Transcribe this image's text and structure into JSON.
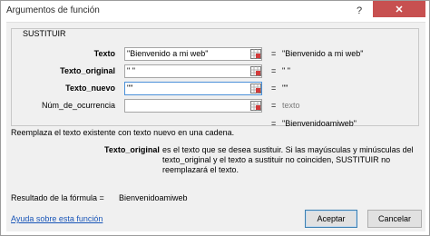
{
  "window": {
    "title": "Argumentos de función",
    "help_icon": "?",
    "close_icon": "✕"
  },
  "group": {
    "legend": "SUSTITUIR"
  },
  "args": [
    {
      "label": "Texto",
      "value": "\"Bienvenido a mi web\"",
      "evaluated": "\"Bienvenido a mi web\"",
      "bold": true
    },
    {
      "label": "Texto_original",
      "value": "\" \"",
      "evaluated": "\" \"",
      "bold": true
    },
    {
      "label": "Texto_nuevo",
      "value": "\"\"",
      "evaluated": "\"\"",
      "bold": true
    },
    {
      "label": "Núm_de_ocurrencia",
      "value": "",
      "evaluated": "texto",
      "bold": false
    }
  ],
  "function_result": "\"Bienvenidoamiweb\"",
  "description": "Reemplaza el texto existente con texto nuevo en una cadena.",
  "param_help": {
    "name": "Texto_original",
    "text": "es el texto que se desea sustituir. Si las mayúsculas y minúsculas del texto_original y el texto a sustituir no coinciden, SUSTITUIR no reemplazará el texto."
  },
  "formula_result": {
    "label": "Resultado de la fórmula =",
    "value": "Bienvenidoamiweb"
  },
  "footer": {
    "help_link": "Ayuda sobre esta función",
    "ok_label": "Aceptar",
    "cancel_label": "Cancelar"
  },
  "colors": {
    "close_button": "#c75050",
    "link": "#1a56b8",
    "focus_border": "#4a90d9"
  }
}
